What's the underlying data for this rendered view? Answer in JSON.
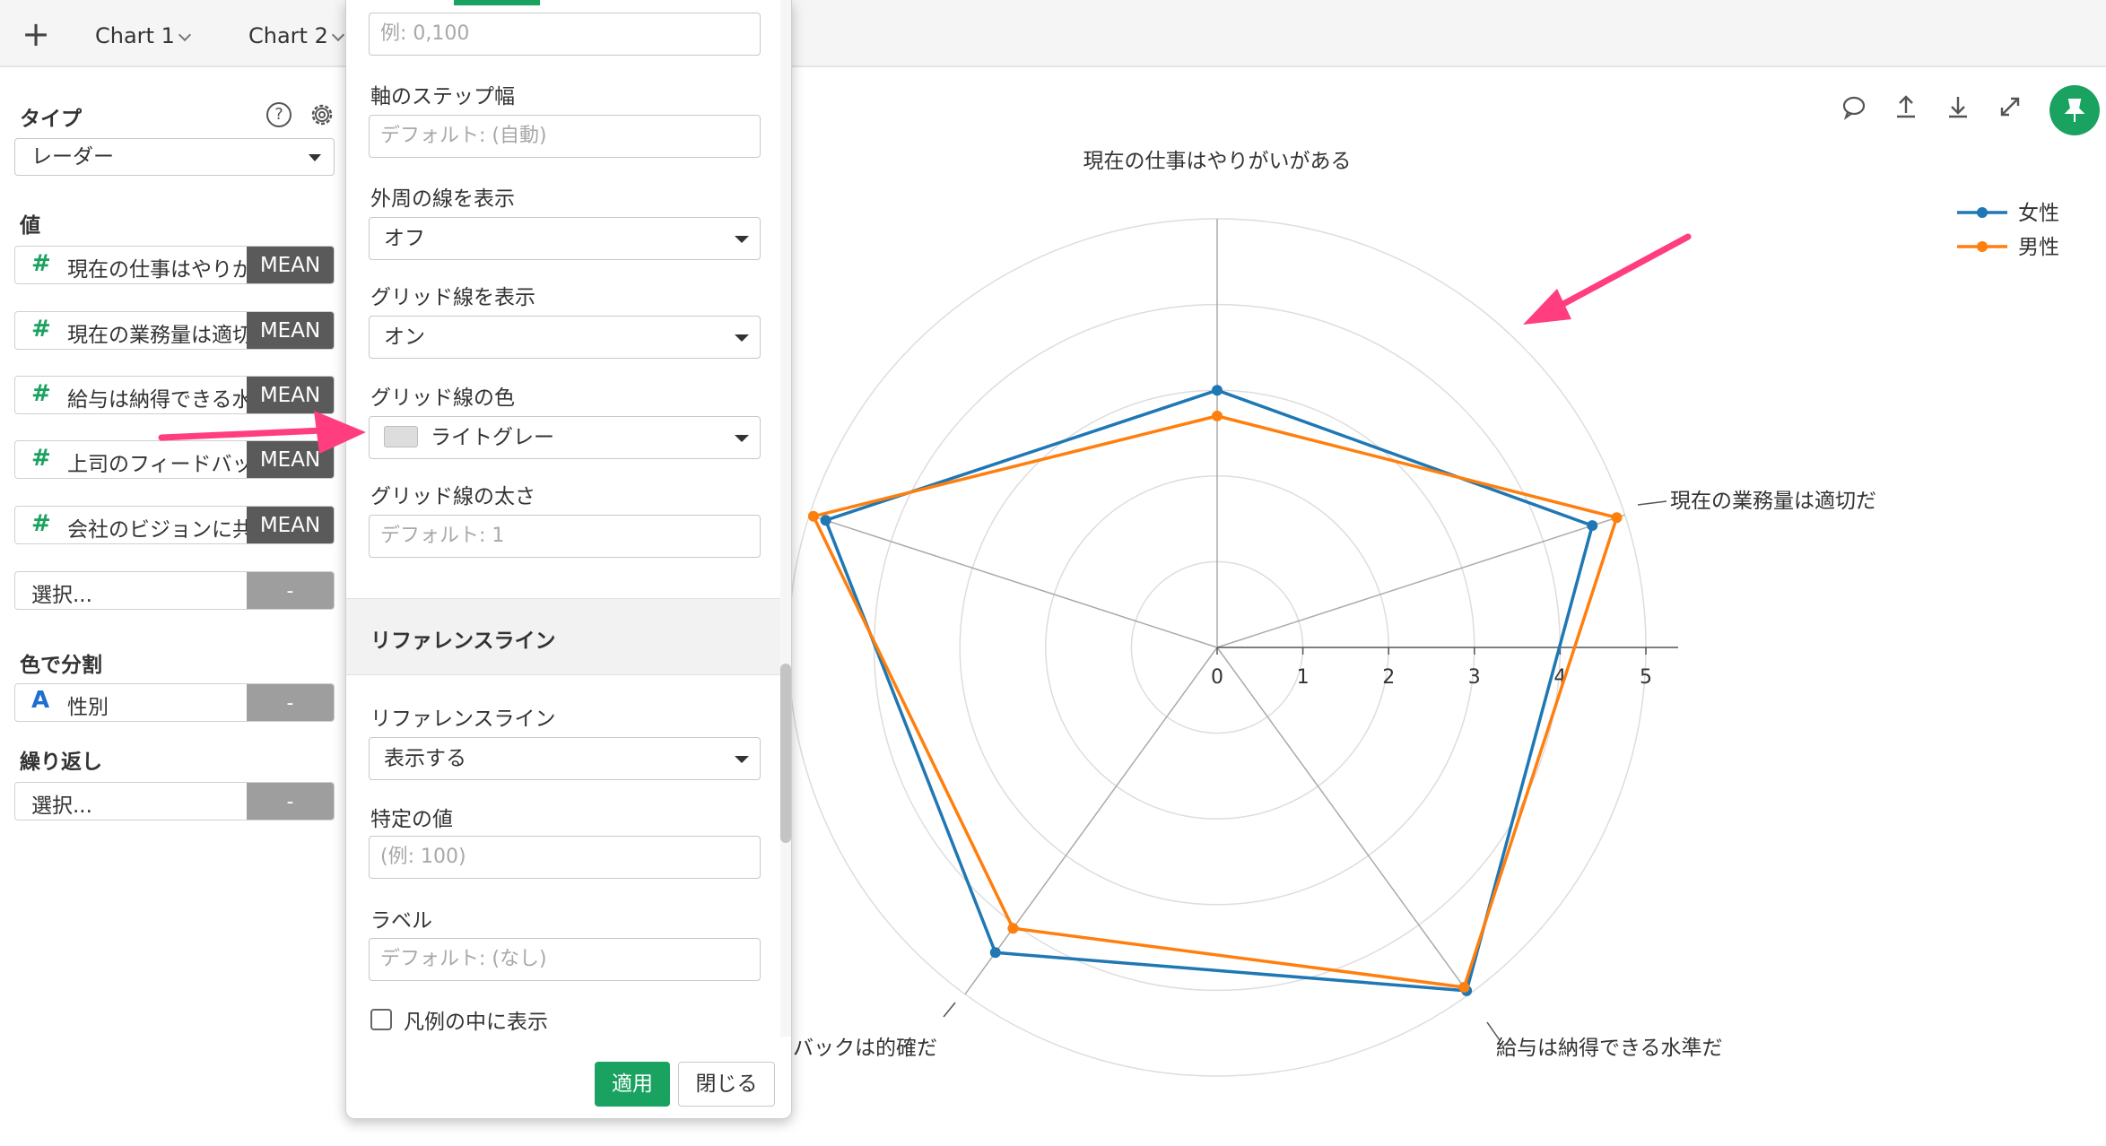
{
  "tabs": {
    "add_label": "+",
    "items": [
      {
        "label": "Chart 1"
      },
      {
        "label": "Chart 2"
      }
    ]
  },
  "sidebar": {
    "type_heading": "タイプ",
    "type_value": "レーダー",
    "values_heading": "値",
    "value_chips": [
      {
        "label": "現在の仕事はやりが",
        "agg": "MEAN"
      },
      {
        "label": "現在の業務量は適切",
        "agg": "MEAN"
      },
      {
        "label": "給与は納得できる水",
        "agg": "MEAN"
      },
      {
        "label": "上司のフィードバッ",
        "agg": "MEAN"
      },
      {
        "label": "会社のビジョンに共",
        "agg": "MEAN"
      }
    ],
    "select_placeholder": "選択...",
    "dash": "-",
    "color_heading": "色で分割",
    "color_chip": {
      "icon": "A",
      "label": "性別"
    },
    "repeat_heading": "繰り返し",
    "help_icon": "?"
  },
  "panel": {
    "range_placeholder": "例: 0,100",
    "step_label": "軸のステップ幅",
    "step_placeholder": "デフォルト: (自動)",
    "outer_line_label": "外周の線を表示",
    "outer_line_value": "オフ",
    "grid_show_label": "グリッド線を表示",
    "grid_show_value": "オン",
    "grid_color_label": "グリッド線の色",
    "grid_color_value": "ライトグレー",
    "grid_color_swatch": "#dddddd",
    "grid_width_label": "グリッド線の太さ",
    "grid_width_placeholder": "デフォルト: 1",
    "ref_section_title": "リファレンスライン",
    "ref_line_label": "リファレンスライン",
    "ref_line_value": "表示する",
    "specific_value_label": "特定の値",
    "specific_value_placeholder": "(例: 100)",
    "ref_label_label": "ラベル",
    "ref_label_placeholder": "デフォルト: (なし)",
    "legend_inside_label": "凡例の中に表示",
    "apply_label": "適用",
    "close_label": "閉じる"
  },
  "colors": {
    "accent_green": "#1aa260",
    "female_series": "#1f77b4",
    "male_series": "#ff7f0e",
    "annotation_arrow": "#ff3d7f"
  },
  "icons": {
    "comment": "comment-icon",
    "upload": "upload-icon",
    "download": "download-icon",
    "expand": "expand-icon",
    "pin": "pin-icon",
    "gear": "gear-icon"
  },
  "chart_data": {
    "type": "radar",
    "axes": [
      "現在の仕事はやりがいがある",
      "現在の業務量は適切だ",
      "給与は納得できる水準だ",
      "上司のフィードバックは的確だ",
      "会社のビジョンに共感できる"
    ],
    "axis_labels_visible": [
      "現在の仕事はやりがいがある",
      "現在の業務量は適切だ",
      "給与は納得できる水準だ",
      "バックは的確だ"
    ],
    "ticks": [
      0,
      1,
      2,
      3,
      4,
      5
    ],
    "range": [
      0,
      5
    ],
    "grid": true,
    "grid_color": "#dddddd",
    "legend_position": "top-right",
    "series": [
      {
        "name": "女性",
        "color": "#1f77b4",
        "values": [
          3.0,
          4.6,
          4.95,
          4.4,
          4.8
        ]
      },
      {
        "name": "男性",
        "color": "#ff7f0e",
        "values": [
          2.7,
          4.9,
          4.9,
          4.05,
          4.95
        ]
      }
    ]
  }
}
